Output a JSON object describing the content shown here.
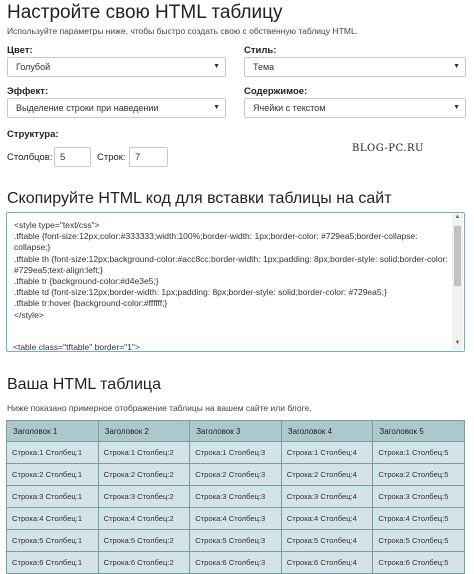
{
  "settings": {
    "title": "Настройте свою HTML таблицу",
    "subtitle": "Используйте параметры ниже, чтобы быстро создать свою с обственную таблицу HTML.",
    "color_label": "Цвет:",
    "color_value": "Голубой",
    "style_label": "Стиль:",
    "style_value": "Тема",
    "effect_label": "Эффект:",
    "effect_value": "Выделение строки при наведении",
    "content_label": "Содержимое:",
    "content_value": "Ячейки с текстом",
    "structure_label": "Структура:",
    "columns_label": "Столбцов:",
    "columns_value": "5",
    "rows_label": "Строк:",
    "rows_value": "7"
  },
  "watermark": "BLOG-PC.RU",
  "code_section": {
    "title": "Скопируйте HTML код для вставки таблицы на сайт",
    "lines": [
      "<style type=\"text/css\">",
      ".tftable {font-size:12px;color:#333333;width:100%;border-width: 1px;border-color: #729ea5;border-collapse: collapse;}",
      ".tftable th {font-size:12px;background-color:#acc8cc;border-width: 1px;padding: 8px;border-style: solid;border-color: #729ea5;text-align:left;}",
      ".tftable tr {background-color:#d4e3e5;}",
      ".tftable td {font-size:12px;border-width: 1px;padding: 8px;border-style: solid;border-color: #729ea5;}",
      ".tftable tr:hover {background-color:#ffffff;}",
      "</style>"
    ],
    "cut_line": "<table class=\"tftable\" border=\"1\">"
  },
  "preview": {
    "title": "Ваша HTML таблица",
    "description": "Ниже показано примерное отображение таблицы на вашем сайте или блоге.",
    "headers": [
      "Заголовок 1",
      "Заголовок 2",
      "Заголовок 3",
      "Заголовок 4",
      "Заголовок 5"
    ],
    "rows": [
      [
        "Строка:1 Столбец:1",
        "Строка:1 Столбец:2",
        "Строка:1 Столбец:3",
        "Строка:1 Столбец:4",
        "Строка:1 Столбец:5"
      ],
      [
        "Строка:2 Столбец:1",
        "Строка:2 Столбец:2",
        "Строка:2 Столбец:3",
        "Строка:2 Столбец:4",
        "Строка:2 Столбец:5"
      ],
      [
        "Строка:3 Столбец:1",
        "Строка:3 Столбец:2",
        "Строка:3 Столбец:3",
        "Строка:3 Столбец:4",
        "Строка:3 Столбец:5"
      ],
      [
        "Строка:4 Столбец:1",
        "Строка:4 Столбец:2",
        "Строка:4 Столбец:3",
        "Строка:4 Столбец:4",
        "Строка:4 Столбец:5"
      ],
      [
        "Строка:5 Столбец:1",
        "Строка:5 Столбец:2",
        "Строка:5 Столбец:3",
        "Строка:5 Столбец:4",
        "Строка:5 Столбец:5"
      ],
      [
        "Строка:6 Столбец:1",
        "Строка:6 Столбец:2",
        "Строка:6 Столбец:3",
        "Строка:6 Столбец:4",
        "Строка:6 Столбец:5"
      ]
    ],
    "colors": {
      "header_bg": "#acc8cc",
      "row_bg": "#d4e3e5",
      "border": "#729ea5",
      "hover_bg": "#ffffff"
    }
  }
}
